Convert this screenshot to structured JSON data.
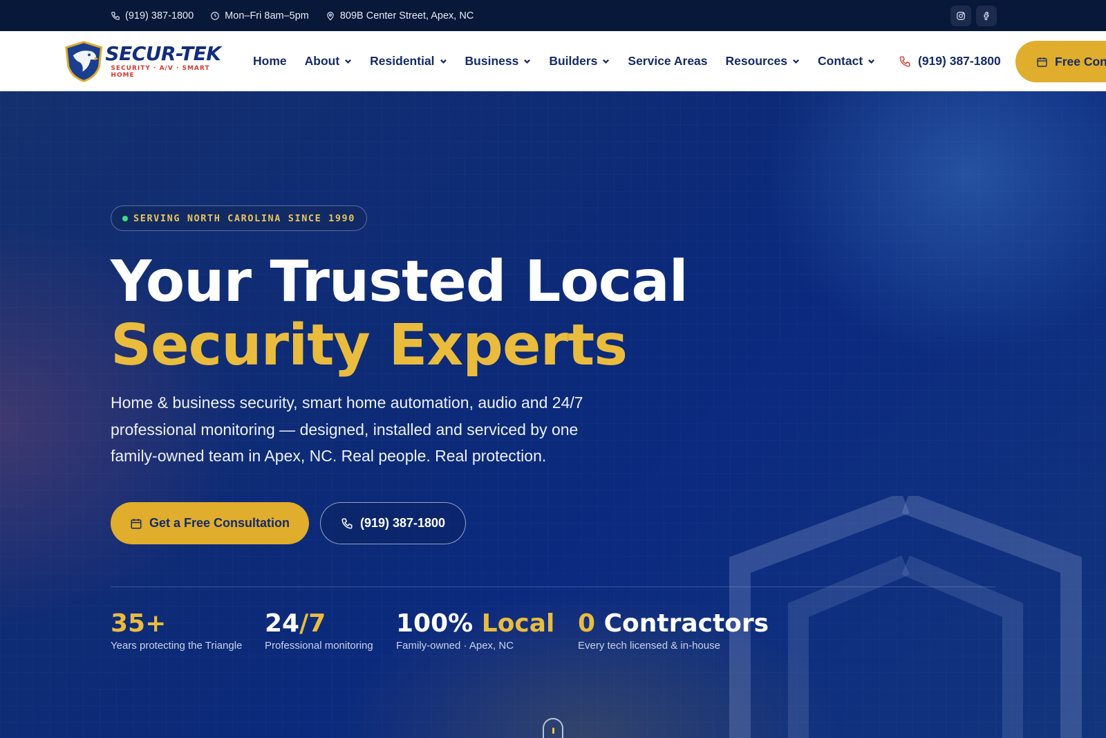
{
  "topbar": {
    "phone": "(919) 387-1800",
    "hours": "Mon–Fri 8am–5pm",
    "address": "809B Center Street, Apex, NC",
    "social": [
      {
        "icon": "instagram-icon"
      },
      {
        "icon": "facebook-icon"
      }
    ]
  },
  "brand": {
    "name": "SECUR-TEK",
    "tagline": "SECURITY · A/V · SMART HOME"
  },
  "nav": {
    "items": [
      {
        "label": "Home",
        "dropdown": false
      },
      {
        "label": "About",
        "dropdown": true
      },
      {
        "label": "Residential",
        "dropdown": true
      },
      {
        "label": "Business",
        "dropdown": true
      },
      {
        "label": "Builders",
        "dropdown": true
      },
      {
        "label": "Service Areas",
        "dropdown": false
      },
      {
        "label": "Resources",
        "dropdown": true
      },
      {
        "label": "Contact",
        "dropdown": true
      }
    ],
    "phone": "(919) 387-1800",
    "cta_label": "Free Consultation"
  },
  "hero": {
    "eyebrow": "SERVING NORTH CAROLINA SINCE 1990",
    "title_line1": "Your Trusted Local",
    "title_line2": "Security Experts",
    "lead": "Home & business security, smart home automation, audio and 24/7 professional monitoring — designed, installed and serviced by one family-owned team in Apex, NC. Real people. Real protection.",
    "primary_cta": "Get a Free Consultation",
    "secondary_cta": "(919) 387-1800"
  },
  "stats": [
    {
      "value_a": "35+",
      "value_b": "",
      "label": "Years protecting the Triangle"
    },
    {
      "value_a": "24",
      "value_b": "/7",
      "label": "Professional monitoring"
    },
    {
      "value_a": "100%",
      "value_b": " Local",
      "label": "Family-owned · Apex, NC"
    },
    {
      "value_a": "0",
      "value_b": " Contractors",
      "label": "Every tech licensed & in-house"
    }
  ],
  "colors": {
    "navy": "#081838",
    "brand_blue": "#142b66",
    "gold": "#e0ad2c",
    "hero_gold_text": "#eabc3e",
    "accent_red": "#d6453a",
    "status_green": "#3ee07a"
  }
}
